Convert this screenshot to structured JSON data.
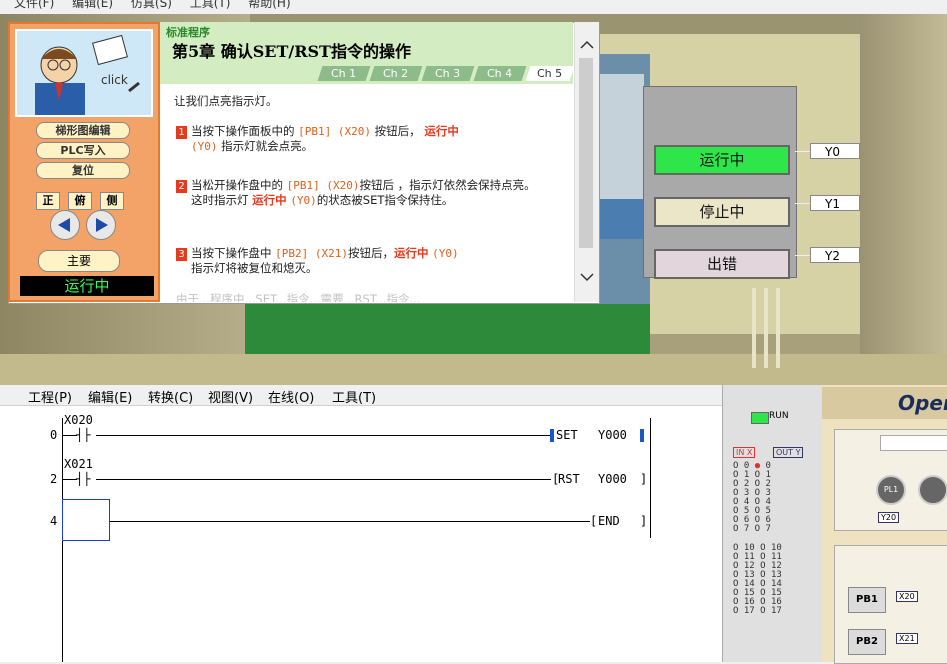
{
  "top_menu": [
    "文件(F)",
    "编辑(E)",
    "仿真(S)",
    "工具(T)",
    "帮助(H)"
  ],
  "tutor": {
    "category": "标准程序",
    "chapter_title": "第5章  确认SET/RST指令的操作",
    "tabs": [
      "Ch 1",
      "Ch 2",
      "Ch 3",
      "Ch 4",
      "Ch 5"
    ],
    "active_tab": "Ch 5",
    "intro": "让我们点亮指示灯。",
    "steps": [
      {
        "num": "1",
        "a": "当按下操作面板中的 ",
        "b": "[PB1] (X20)",
        "c": " 按钮后， ",
        "d": "运行中",
        "e": "(Y0)",
        "f": " 指示灯就会点亮。"
      },
      {
        "num": "2",
        "a": "当松开操作盘中的 ",
        "b": "[PB1] (X20)",
        "c": "按钮后 ，指示灯依然会保持点亮。",
        "d": "这时指示灯 ",
        "e": "运行中",
        "f": "(Y0)",
        "g": "的状态被SET指令保持住。"
      },
      {
        "num": "3",
        "a": "当按下操作盘中 ",
        "b": "[PB2] (X21)",
        "c": "按钮后，",
        "d": "运行中",
        "e": "(Y0)",
        "f": "指示灯将被复位和熄灭。"
      }
    ],
    "truncated_line": "由于...程序中...SET...指令...需要...RST...指令..."
  },
  "left_panel": {
    "click_label": "click",
    "buttons": [
      "梯形图编辑",
      "PLC写入",
      "复位"
    ],
    "views": [
      "正",
      "俯",
      "侧"
    ],
    "main_label": "主要",
    "run_status": "运行中"
  },
  "panel": {
    "lamps": [
      {
        "label": "运行中",
        "tag": "Y0",
        "color": "#2ee64a"
      },
      {
        "label": "停止中",
        "tag": "Y1",
        "color": "#ece6c8"
      },
      {
        "label": "出错",
        "tag": "Y2",
        "color": "#e2d6dc"
      }
    ]
  },
  "ladder": {
    "menu": [
      "工程(P)",
      "编辑(E)",
      "转换(C)",
      "视图(V)",
      "在线(O)",
      "工具(T)"
    ],
    "rungs": [
      {
        "step": "0",
        "contact": "X020",
        "instr": "SET",
        "dev": "Y000"
      },
      {
        "step": "2",
        "contact": "X021",
        "instr": "RST",
        "dev": "Y000"
      },
      {
        "step": "4",
        "contact": "",
        "instr": "END",
        "dev": ""
      }
    ]
  },
  "plc": {
    "run_label": "RUN",
    "in_label": "IN X",
    "out_label": "OUT Y",
    "io_rows": [
      "0",
      "1",
      "2",
      "3",
      "4",
      "5",
      "6",
      "7",
      "10",
      "11",
      "12",
      "13",
      "14",
      "15",
      "16",
      "17"
    ]
  },
  "operation": {
    "title": "Oper",
    "pl1": "PL1",
    "y20": "Y20",
    "pb1": "PB1",
    "x20": "X20",
    "pb2": "PB2",
    "x21": "X21"
  }
}
